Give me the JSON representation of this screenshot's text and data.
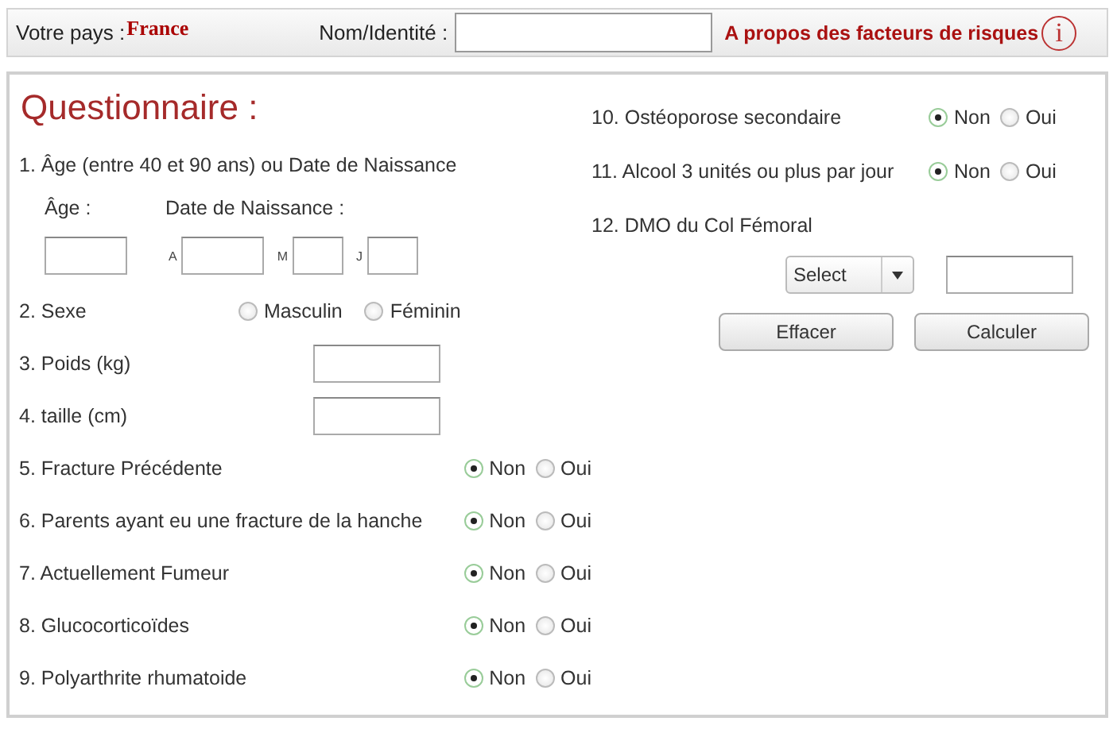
{
  "header": {
    "country_label": "Votre pays :",
    "country": "France",
    "name_label": "Nom/Identité :",
    "about_link": "A propos des facteurs de risques",
    "info_icon": "i"
  },
  "title": "Questionnaire :",
  "left_column": [
    {
      "kind": "age",
      "label": "1. Âge (entre 40 et 90 ans) ou Date de Naissance",
      "age_label": "Âge :",
      "dob_label": "Date de Naissance :",
      "dob_fields": [
        "A",
        "M",
        "J"
      ]
    },
    {
      "kind": "sex",
      "label": "2. Sexe",
      "options": [
        {
          "label": "Masculin",
          "selected": false
        },
        {
          "label": "Féminin",
          "selected": false
        }
      ]
    },
    {
      "kind": "input",
      "label": "3. Poids (kg)"
    },
    {
      "kind": "input",
      "label": "4. taille (cm)"
    },
    {
      "kind": "choice",
      "label": "5. Fracture Précédente",
      "options": [
        {
          "label": "Non",
          "selected": true
        },
        {
          "label": "Oui",
          "selected": false
        }
      ]
    },
    {
      "kind": "choice",
      "label": "6. Parents ayant eu une fracture de la hanche",
      "options": [
        {
          "label": "Non",
          "selected": true
        },
        {
          "label": "Oui",
          "selected": false
        }
      ]
    },
    {
      "kind": "choice",
      "label": "7. Actuellement Fumeur",
      "options": [
        {
          "label": "Non",
          "selected": true
        },
        {
          "label": "Oui",
          "selected": false
        }
      ]
    },
    {
      "kind": "choice",
      "label": "8. Glucocorticoïdes",
      "options": [
        {
          "label": "Non",
          "selected": true
        },
        {
          "label": "Oui",
          "selected": false
        }
      ]
    },
    {
      "kind": "choice",
      "label": "9. Polyarthrite rhumatoide",
      "options": [
        {
          "label": "Non",
          "selected": true
        },
        {
          "label": "Oui",
          "selected": false
        }
      ]
    }
  ],
  "right_column": [
    {
      "kind": "choice",
      "label": "10. Ostéoporose secondaire",
      "options": [
        {
          "label": "Non",
          "selected": true
        },
        {
          "label": "Oui",
          "selected": false
        }
      ]
    },
    {
      "kind": "choice",
      "label": "11. Alcool 3 unités ou plus par jour",
      "options": [
        {
          "label": "Non",
          "selected": true
        },
        {
          "label": "Oui",
          "selected": false
        }
      ]
    },
    {
      "kind": "bmd",
      "label": "12. DMO du Col Fémoral",
      "select": "Select"
    }
  ],
  "buttons": [
    "Effacer",
    "Calculer"
  ]
}
